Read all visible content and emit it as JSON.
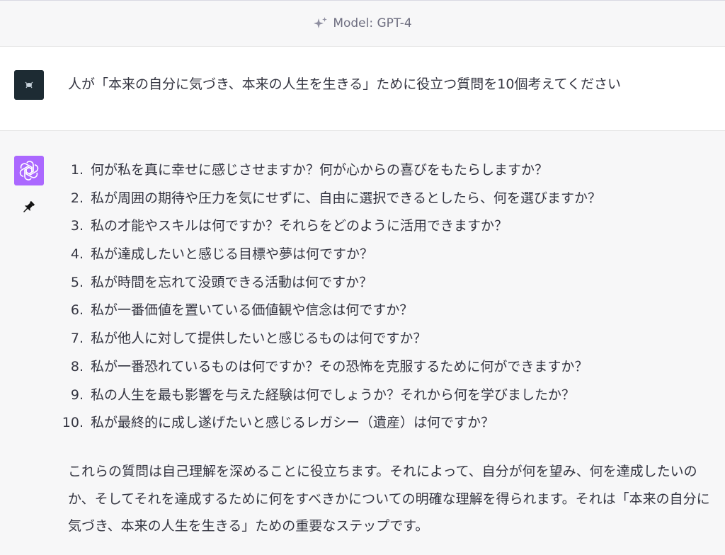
{
  "header": {
    "model_label": "Model: GPT-4"
  },
  "user_message": {
    "text": "人が「本来の自分に気づき、本来の人生を生きる」ために役立つ質問を10個考えてください"
  },
  "assistant_message": {
    "questions": [
      {
        "num": "1.",
        "text": "何が私を真に幸せに感じさせますか？何が心からの喜びをもたらしますか？"
      },
      {
        "num": "2.",
        "text": "私が周囲の期待や圧力を気にせずに、自由に選択できるとしたら、何を選びますか？"
      },
      {
        "num": "3.",
        "text": "私の才能やスキルは何ですか？それらをどのように活用できますか？"
      },
      {
        "num": "4.",
        "text": "私が達成したいと感じる目標や夢は何ですか？"
      },
      {
        "num": "5.",
        "text": "私が時間を忘れて没頭できる活動は何ですか？"
      },
      {
        "num": "6.",
        "text": "私が一番価値を置いている価値観や信念は何ですか？"
      },
      {
        "num": "7.",
        "text": "私が他人に対して提供したいと感じるものは何ですか？"
      },
      {
        "num": "8.",
        "text": "私が一番恐れているものは何ですか？その恐怖を克服するために何ができますか？"
      },
      {
        "num": "9.",
        "text": "私の人生を最も影響を与えた経験は何でしょうか？それから何を学びましたか？"
      },
      {
        "num": "10.",
        "text": "私が最終的に成し遂げたいと感じるレガシー（遺産）は何ですか？"
      }
    ],
    "summary": "これらの質問は自己理解を深めることに役立ちます。それによって、自分が何を望み、何を達成したいのか、そしてそれを達成するために何をすべきかについての明確な理解を得られます。それは「本来の自分に気づき、本来の人生を生きる」ための重要なステップです。"
  },
  "icons": {
    "sparkle": "sparkle-icon",
    "user_avatar": "user-avatar",
    "assistant_avatar": "openai-logo-icon",
    "pin": "pin-icon"
  },
  "colors": {
    "assistant_avatar_bg": "#ab68ff",
    "user_avatar_bg": "#1d2b33"
  }
}
